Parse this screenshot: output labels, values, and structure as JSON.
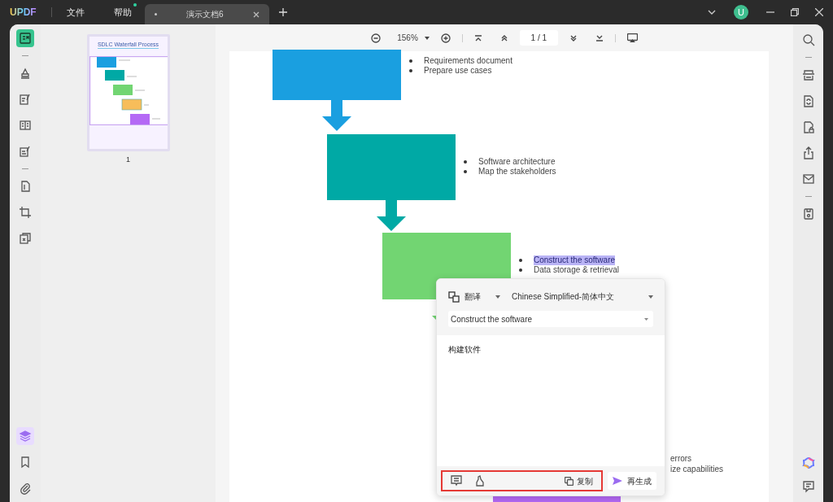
{
  "titlebar": {
    "logo": "UPDF",
    "menus": [
      {
        "label": "文件",
        "badge": false
      },
      {
        "label": "帮助",
        "badge": true
      }
    ],
    "tabs": [
      {
        "title": "演示文档6",
        "selected": true,
        "unsaved": true
      }
    ],
    "avatar": "U"
  },
  "left_tools": [
    {
      "kind": "reader",
      "selected": true
    },
    {
      "kind": "divider"
    },
    {
      "kind": "comment",
      "selected": false
    },
    {
      "kind": "edit",
      "selected": false
    },
    {
      "kind": "columns",
      "selected": false
    },
    {
      "kind": "sign",
      "selected": false
    },
    {
      "kind": "divider"
    },
    {
      "kind": "pages",
      "selected": false
    },
    {
      "kind": "crop",
      "selected": false
    },
    {
      "kind": "combine",
      "selected": false
    }
  ],
  "left_bottom_tools": [
    {
      "kind": "layers",
      "selected": true
    },
    {
      "kind": "bookmark",
      "selected": false
    },
    {
      "kind": "attachment",
      "selected": false
    }
  ],
  "toolbar": {
    "zoom": "156%",
    "page": "1 / 1"
  },
  "thumbnails": [
    {
      "title": "SDLC Waterfall Process",
      "page": "1",
      "selected": true
    }
  ],
  "document": {
    "steps": [
      {
        "color": "#1a9fe0",
        "bullets": [
          {
            "text": "Requirements document",
            "highlighted": false
          },
          {
            "text": "Prepare use cases",
            "highlighted": false
          }
        ]
      },
      {
        "color": "#00a9a5",
        "bullets": [
          {
            "text": "Software architecture",
            "highlighted": false
          },
          {
            "text": "Map the stakeholders",
            "highlighted": false
          }
        ]
      },
      {
        "color": "#72d572",
        "bullets": [
          {
            "text": "Construct the software",
            "highlighted": true
          },
          {
            "text": "Data storage & retrieval",
            "highlighted": false
          }
        ]
      }
    ],
    "lower_bullets": [
      "errors",
      "ize capabilities"
    ]
  },
  "translate_panel": {
    "mode": "翻译",
    "language": "Chinese Simplified-简体中文",
    "source": "Construct the software",
    "result": "构建软件",
    "copy": "复制",
    "regenerate": "再生成"
  },
  "right_tools": [
    {
      "kind": "search"
    },
    {
      "kind": "divider"
    },
    {
      "kind": "ocr"
    },
    {
      "kind": "convert"
    },
    {
      "kind": "protect"
    },
    {
      "kind": "share"
    },
    {
      "kind": "mail"
    },
    {
      "kind": "divider"
    },
    {
      "kind": "save"
    }
  ],
  "right_bottom_tools": [
    {
      "kind": "ai"
    },
    {
      "kind": "chat"
    }
  ]
}
